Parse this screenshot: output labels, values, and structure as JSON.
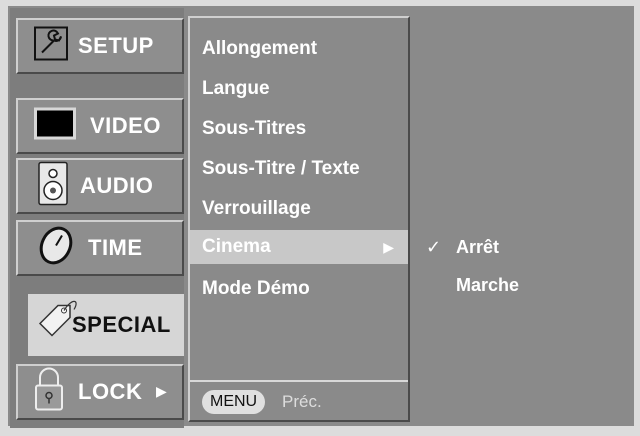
{
  "categories": [
    {
      "label": "SETUP",
      "icon": "wrench-icon"
    },
    {
      "label": "VIDEO",
      "icon": "monitor-icon"
    },
    {
      "label": "AUDIO",
      "icon": "speaker-icon"
    },
    {
      "label": "TIME",
      "icon": "clock-icon"
    },
    {
      "label": "SPECIAL",
      "icon": "tag-icon"
    },
    {
      "label": "LOCK",
      "icon": "padlock-icon"
    }
  ],
  "active_category": "SPECIAL",
  "lock_arrow": "▶",
  "menu": {
    "items": [
      "Allongement",
      "Langue",
      "Sous-Titres",
      "Sous-Titre / Texte",
      "Verrouillage",
      "Cinema",
      "Mode Démo"
    ],
    "selected_item": "Cinema",
    "selected_arrow": "▶",
    "footer_button": "MENU",
    "footer_text": "Préc."
  },
  "submenu": {
    "items": [
      "Arrêt",
      "Marche"
    ],
    "checked": "Arrêt",
    "check_mark": "✓"
  }
}
